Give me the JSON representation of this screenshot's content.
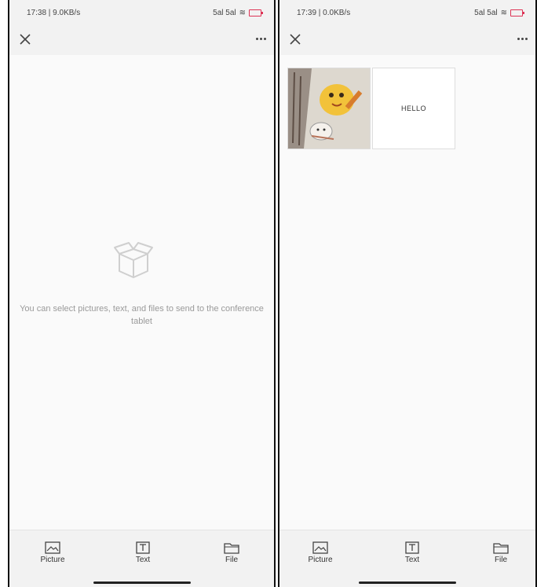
{
  "left_screen": {
    "status": {
      "time": "17:38 | 9.0KB/s",
      "network": "5al 5al"
    },
    "empty_message": "You can select pictures, text, and files to send to the conference tablet",
    "tabs": [
      {
        "label": "Picture",
        "icon": "picture-icon"
      },
      {
        "label": "Text",
        "icon": "text-icon"
      },
      {
        "label": "File",
        "icon": "folder-icon"
      }
    ]
  },
  "right_screen": {
    "status": {
      "time": "17:39 | 0.0KB/s",
      "network": "5al 5al"
    },
    "items": [
      {
        "type": "image",
        "icon": "cartoon-image-thumbnail"
      },
      {
        "type": "text",
        "content": "HELLO"
      }
    ],
    "tabs": [
      {
        "label": "Picture",
        "icon": "picture-icon"
      },
      {
        "label": "Text",
        "icon": "text-icon"
      },
      {
        "label": "File",
        "icon": "folder-icon"
      }
    ]
  },
  "colors": {
    "background": "#f7f7f7",
    "text_muted": "#9a9a9a",
    "battery": "#dd3355"
  }
}
